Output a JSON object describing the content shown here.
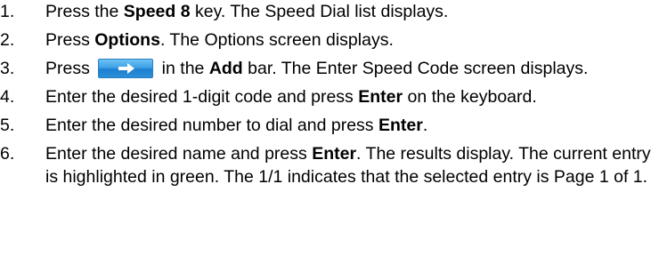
{
  "steps": [
    {
      "num": "1.",
      "parts": [
        "Press the ",
        "Speed 8",
        " key. The Speed Dial list displays."
      ]
    },
    {
      "num": "2.",
      "parts": [
        "Press ",
        "Options",
        ". The Options screen displays."
      ]
    },
    {
      "num": "3.",
      "before_icon": "Press ",
      "icon": "arrow-right-icon",
      "parts": [
        " in the ",
        "Add",
        " bar. The Enter Speed Code screen displays."
      ]
    },
    {
      "num": "4.",
      "parts": [
        "Enter the desired 1-digit code and press ",
        "Enter",
        " on the keyboard."
      ]
    },
    {
      "num": "5.",
      "parts": [
        "Enter the desired number to dial and press ",
        "Enter",
        "."
      ]
    },
    {
      "num": "6.",
      "parts": [
        "Enter the desired name and press ",
        "Enter",
        ". The results display. The current entry is highlighted in green.  The 1/1 indicates that the selected entry is Page 1 of 1."
      ]
    }
  ],
  "colors": {
    "text": "#000000",
    "icon_button": "#3ea0e6"
  }
}
